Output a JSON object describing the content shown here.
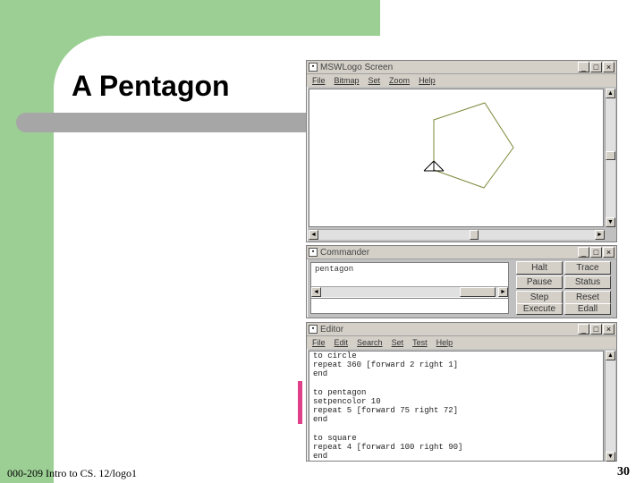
{
  "slide": {
    "title": "A Pentagon",
    "footer": "000-209 Intro to CS. 12/logo1",
    "page_number": "30"
  },
  "logo_window": {
    "title": "MSWLogo Screen",
    "menu": [
      "File",
      "Bitmap",
      "Set",
      "Zoom",
      "Help"
    ],
    "pen_color": "#7a8a3a"
  },
  "commander_window": {
    "title": "Commander",
    "history": "pentagon",
    "buttons": [
      {
        "label": "Halt"
      },
      {
        "label": "Trace"
      },
      {
        "label": "Pause"
      },
      {
        "label": "Status"
      },
      {
        "label": "Step"
      },
      {
        "label": "Reset"
      },
      {
        "label": "Execute"
      },
      {
        "label": "Edall"
      }
    ]
  },
  "editor_window": {
    "title": "Editor",
    "menu": [
      "File",
      "Edit",
      "Search",
      "Set",
      "Test",
      "Help"
    ],
    "lines": [
      "to circle",
      "repeat 360 [forward 2 right 1]",
      "end",
      "",
      "to pentagon",
      "setpencolor 10",
      "repeat 5 [forward 75 right 72]",
      "end",
      "",
      "to square",
      "repeat 4 [forward 100 right 90]",
      "end"
    ]
  },
  "colors": {
    "slide_green": "#9ccf94",
    "accent_gray": "#a6a6a6",
    "accent_pink": "#e0408a"
  }
}
